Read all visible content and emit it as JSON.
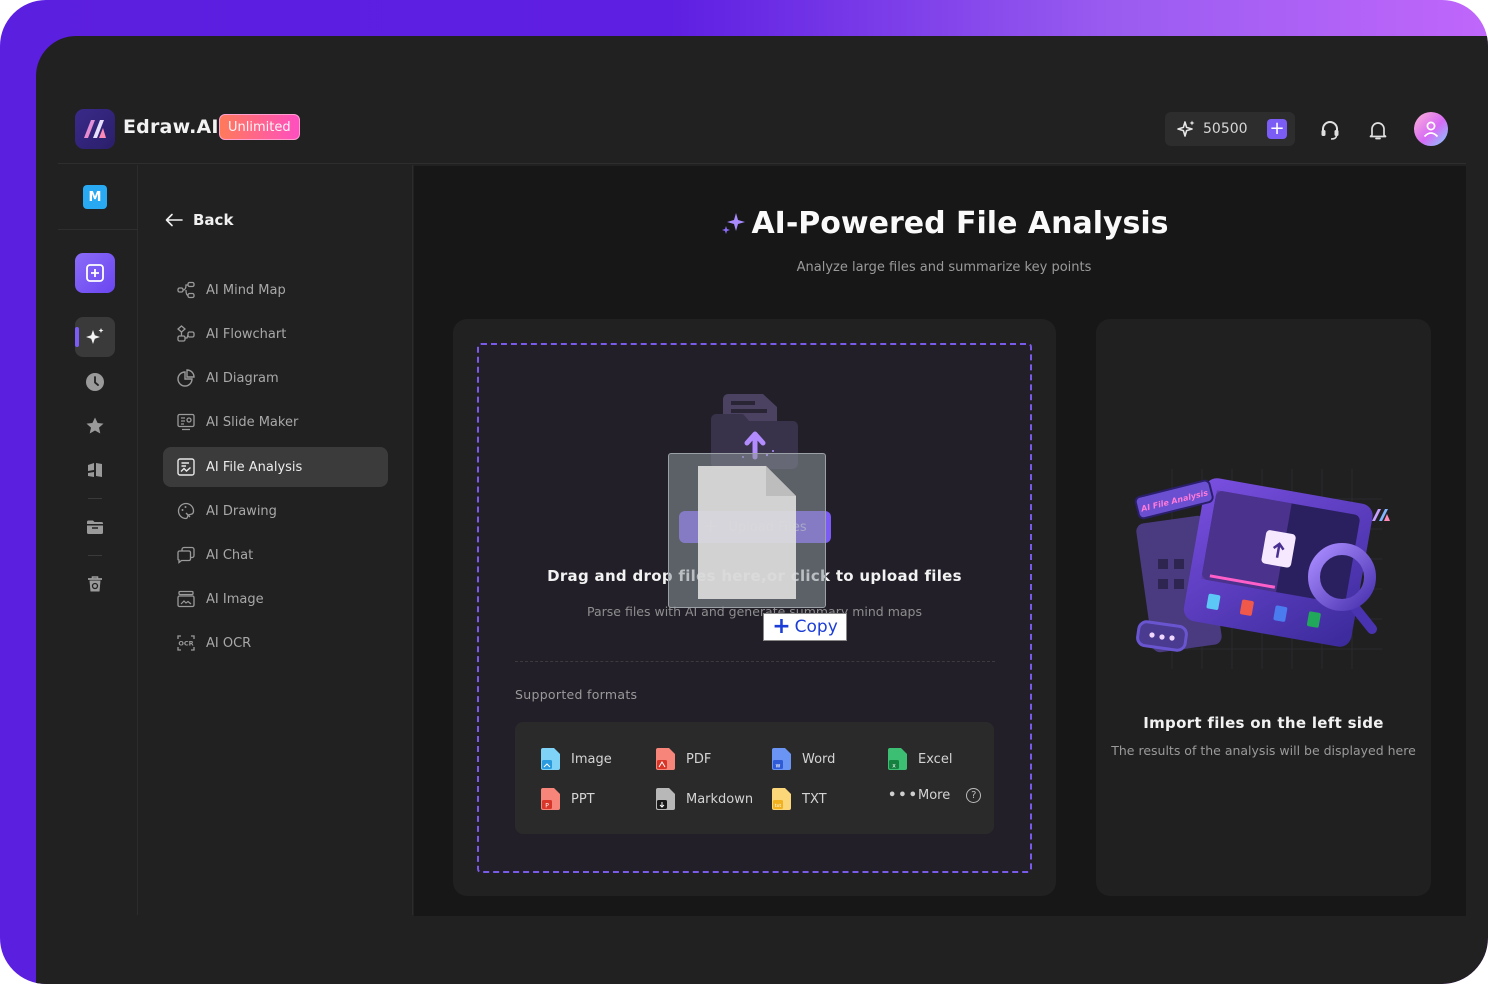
{
  "app": {
    "brand": "Edraw.AI",
    "plan_badge": "Unlimited",
    "credits": "50500",
    "workspace_initial": "M",
    "accent_color": "#7b5cf5"
  },
  "header_icons": [
    "sparkle-icon",
    "add-credits-icon",
    "headset-icon",
    "bell-icon",
    "avatar"
  ],
  "rail": {
    "items": [
      "new-file",
      "ai-tools",
      "recent",
      "favorites",
      "templates",
      "my-files",
      "trash"
    ]
  },
  "subnav": {
    "back_label": "Back",
    "items": [
      {
        "label": "AI Mind Map",
        "icon": "mind-map-icon"
      },
      {
        "label": "AI Flowchart",
        "icon": "flowchart-icon"
      },
      {
        "label": "AI Diagram",
        "icon": "pie-diagram-icon"
      },
      {
        "label": "AI Slide Maker",
        "icon": "slide-icon"
      },
      {
        "label": "AI File Analysis",
        "icon": "file-analysis-icon",
        "active": true
      },
      {
        "label": "AI Drawing",
        "icon": "palette-icon"
      },
      {
        "label": "AI Chat",
        "icon": "chat-icon"
      },
      {
        "label": "AI Image",
        "icon": "image-icon"
      },
      {
        "label": "AI OCR",
        "icon": "ocr-icon"
      }
    ]
  },
  "main": {
    "title": "AI-Powered File Analysis",
    "subtitle": "Analyze large files and summarize key points",
    "upload": {
      "button_label": "Upload Files",
      "drop_title": "Drag and drop files here,or click to upload files",
      "drop_subtitle": "Parse files with AI and generate summary mind maps",
      "drag_tooltip": "Copy",
      "formats_label": "Supported formats",
      "formats": [
        {
          "label": "Image",
          "color": "#5cc8f5"
        },
        {
          "label": "PDF",
          "color": "#f0584a"
        },
        {
          "label": "Word",
          "color": "#4a7cf0"
        },
        {
          "label": "Excel",
          "color": "#21a85a"
        },
        {
          "label": "PPT",
          "color": "#f0584a"
        },
        {
          "label": "Markdown",
          "color": "#9a9a9a"
        },
        {
          "label": "TXT",
          "color": "#f7c548"
        },
        {
          "label": "More",
          "color": "#cccccc"
        }
      ]
    },
    "result": {
      "illustration_tag": "AI File Analysis",
      "title": "Import files on the left side",
      "subtitle": "The results of the analysis will be displayed here"
    }
  }
}
